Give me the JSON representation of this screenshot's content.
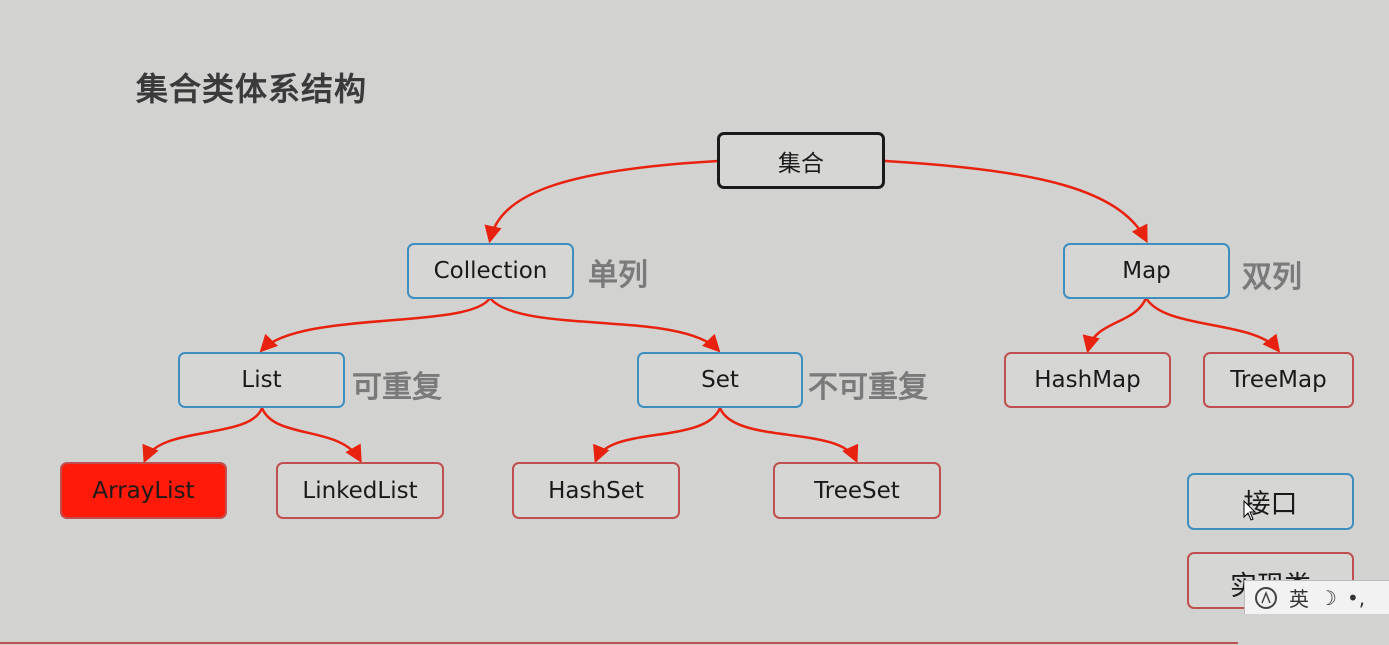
{
  "title": "集合类体系结构",
  "nodes": {
    "root": "集合",
    "collection": "Collection",
    "map": "Map",
    "list": "List",
    "set": "Set",
    "hashmap": "HashMap",
    "treemap": "TreeMap",
    "arraylist": "ArrayList",
    "linkedlist": "LinkedList",
    "hashset": "HashSet",
    "treeset": "TreeSet"
  },
  "notes": {
    "collection": "单列",
    "map": "双列",
    "list": "可重复",
    "set": "不可重复"
  },
  "legend": {
    "interface": "接口",
    "impl": "实现类"
  },
  "ime": {
    "lang": "英"
  },
  "colors": {
    "edge": "#e8220e",
    "interface_border": "#3e8fc0",
    "impl_border": "#c0504d",
    "highlight_fill": "#ff1a0a"
  }
}
